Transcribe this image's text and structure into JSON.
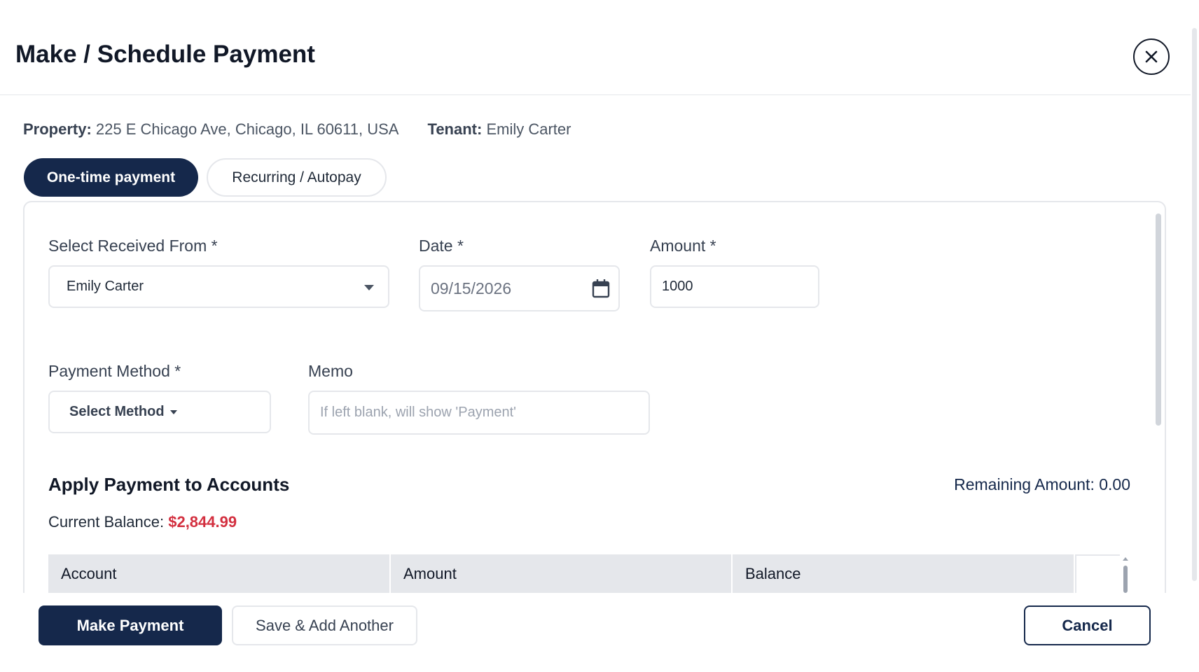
{
  "modal": {
    "title": "Make / Schedule Payment",
    "close_icon": "close-icon"
  },
  "info": {
    "property_label": "Property:",
    "property_value": "225 E Chicago Ave, Chicago, IL 60611, USA",
    "tenant_label": "Tenant:",
    "tenant_value": "Emily Carter"
  },
  "tabs": [
    {
      "label": "One-time payment",
      "active": true
    },
    {
      "label": "Recurring / Autopay",
      "active": false
    }
  ],
  "form": {
    "received_from": {
      "label": "Select Received From *",
      "value": "Emily Carter"
    },
    "date": {
      "label": "Date *",
      "value": "09/15/2026"
    },
    "amount": {
      "label": "Amount *",
      "value": "1000"
    },
    "payment_method": {
      "label": "Payment Method *",
      "value": "Select Method"
    },
    "memo": {
      "label": "Memo",
      "placeholder": "If left blank, will show 'Payment'"
    }
  },
  "apply": {
    "title": "Apply Payment to Accounts",
    "remaining": "Remaining Amount: 0.00",
    "current_balance_label": "Current Balance:",
    "current_balance_value": "$2,844.99",
    "columns": [
      "Account",
      "Amount",
      "Balance"
    ]
  },
  "footer": {
    "make_payment": "Make Payment",
    "save_add_another": "Save & Add Another",
    "cancel": "Cancel"
  },
  "colors": {
    "primary": "#15284b",
    "negative_balance": "#d32f3f",
    "border": "#e5e7eb"
  }
}
